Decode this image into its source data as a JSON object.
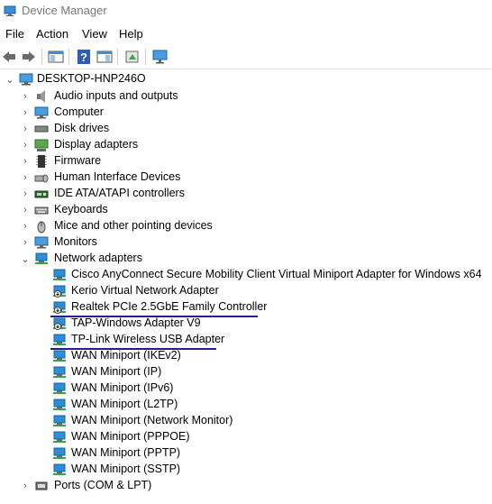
{
  "window": {
    "title": "Device Manager"
  },
  "menu": [
    "File",
    "Action",
    "View",
    "Help"
  ],
  "toolbar": [
    "back-icon",
    "forward-icon",
    "show-hide-console-tree-icon",
    "help-icon",
    "properties-icon",
    "update-driver-icon",
    "scan-hardware-changes-icon"
  ],
  "tree": {
    "root": "DESKTOP-HNP246O",
    "categories": [
      "Audio inputs and outputs",
      "Computer",
      "Disk drives",
      "Display adapters",
      "Firmware",
      "Human Interface Devices",
      "IDE ATA/ATAPI controllers",
      "Keyboards",
      "Mice and other pointing devices",
      "Monitors",
      "Network adapters"
    ],
    "network_adapters": [
      "Cisco AnyConnect Secure Mobility Client Virtual Miniport Adapter for Windows x64",
      "Kerio Virtual Network Adapter",
      "Realtek PCIe 2.5GbE Family Controller",
      "TAP-Windows Adapter V9",
      "TP-Link Wireless USB Adapter",
      "WAN Miniport (IKEv2)",
      "WAN Miniport (IP)",
      "WAN Miniport (IPv6)",
      "WAN Miniport (L2TP)",
      "WAN Miniport (Network Monitor)",
      "WAN Miniport (PPPOE)",
      "WAN Miniport (PPTP)",
      "WAN Miniport (SSTP)"
    ],
    "after": [
      "Ports (COM & LPT)"
    ]
  },
  "colors": {
    "highlight_underline": "#2a1a8c",
    "monitor_blue": "#2b8fd6"
  }
}
